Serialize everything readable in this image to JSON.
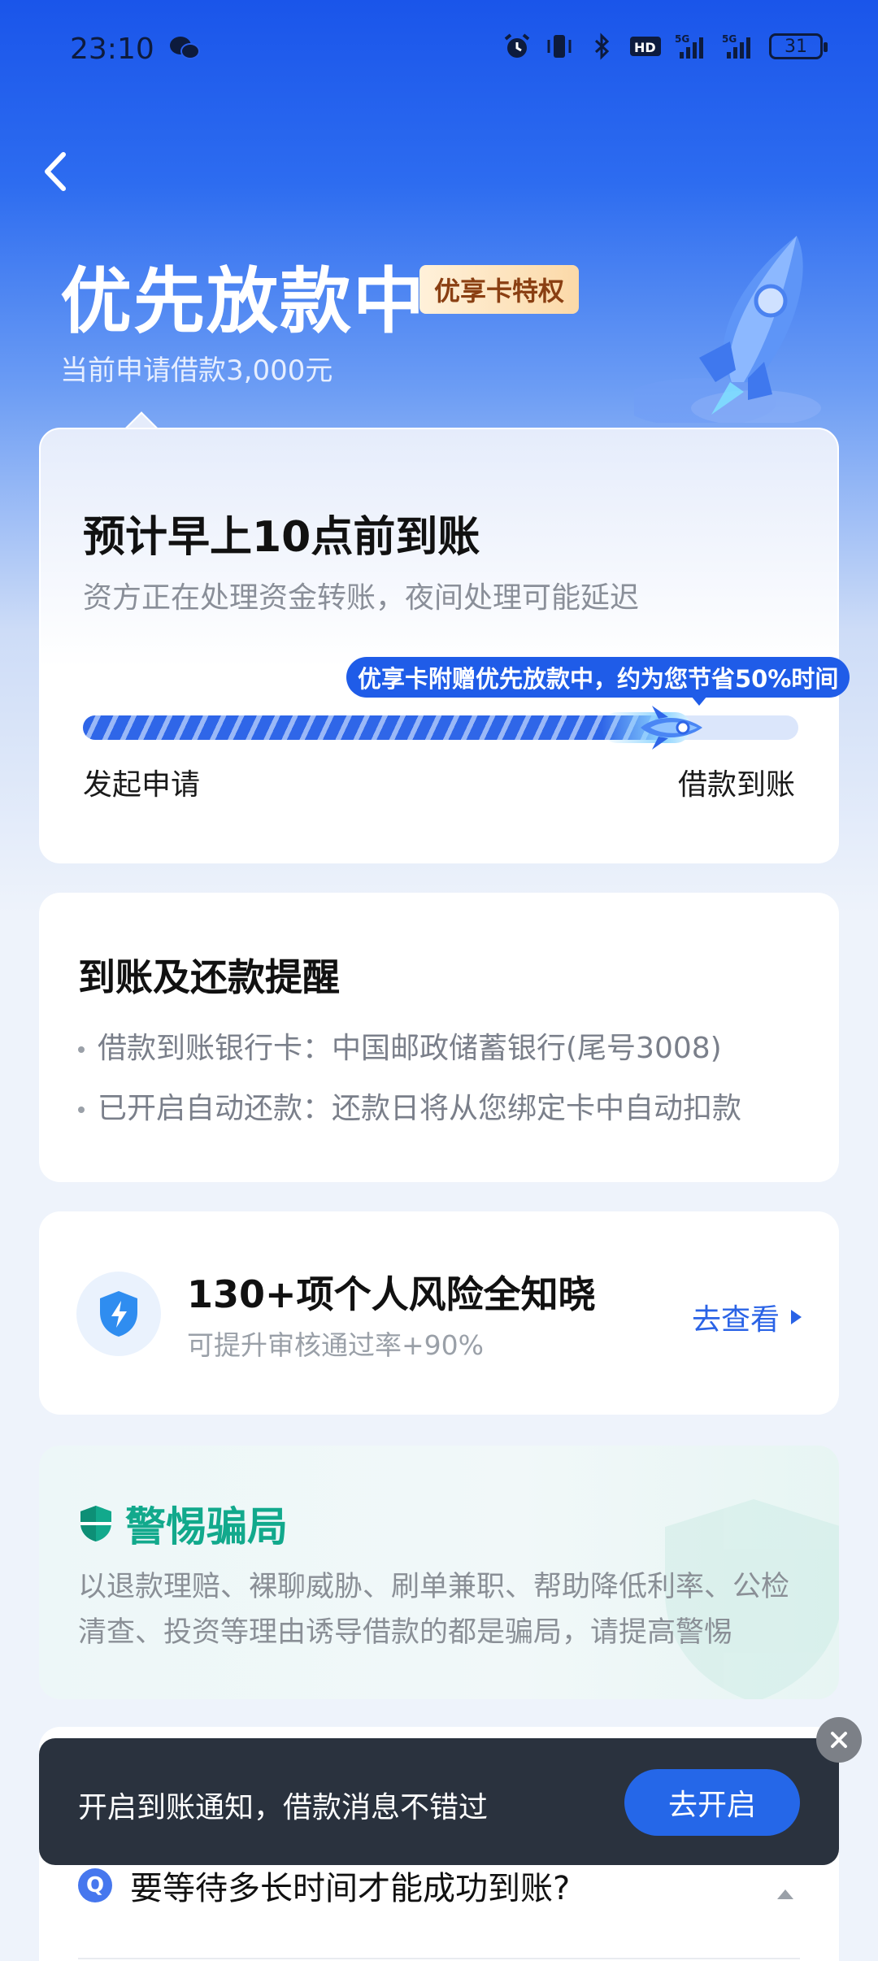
{
  "status_bar": {
    "time": "23:10",
    "battery": "31",
    "icons": [
      "wechat-icon",
      "alarm-icon",
      "vibrate-icon",
      "bluetooth-icon",
      "hd-icon",
      "5g-signal-icon",
      "5g-signal-icon",
      "battery-icon"
    ]
  },
  "hero": {
    "title": "优先放款中",
    "badge": "优享卡特权",
    "subtitle": "当前申请借款3,000元"
  },
  "progress_card": {
    "title": "预计早上10点前到账",
    "subtitle": "资方正在处理资金转账，夜间处理可能延迟",
    "tip": "优享卡附赠优先放款中，约为您节省50%时间",
    "progress_fraction": 0.85,
    "start_label": "发起申请",
    "end_label": "借款到账"
  },
  "reminder_card": {
    "title": "到账及还款提醒",
    "lines": [
      "借款到账银行卡：中国邮政储蓄银行(尾号3008)",
      "已开启自动还款：还款日将从您绑定卡中自动扣款"
    ]
  },
  "risk_card": {
    "title": "130+项个人风险全知晓",
    "subtitle": "可提升审核通过率+90%",
    "link": "去查看"
  },
  "fraud_card": {
    "title": "警惕骗局",
    "text": "以退款理赔、裸聊威胁、刷单兼职、帮助降低利率、公检清查、投资等理由诱导借款的都是骗局，请提高警惕"
  },
  "faq": {
    "badge": "Q",
    "question": "要等待多长时间才能成功到账?"
  },
  "toast": {
    "text": "开启到账通知，借款消息不错过",
    "button": "去开启"
  },
  "colors": {
    "primary": "#2567e8",
    "hero_top": "#1a55ea",
    "badge_text": "#8a3f12",
    "fraud_green": "#12a98c",
    "toast_bg": "#2a323e"
  }
}
